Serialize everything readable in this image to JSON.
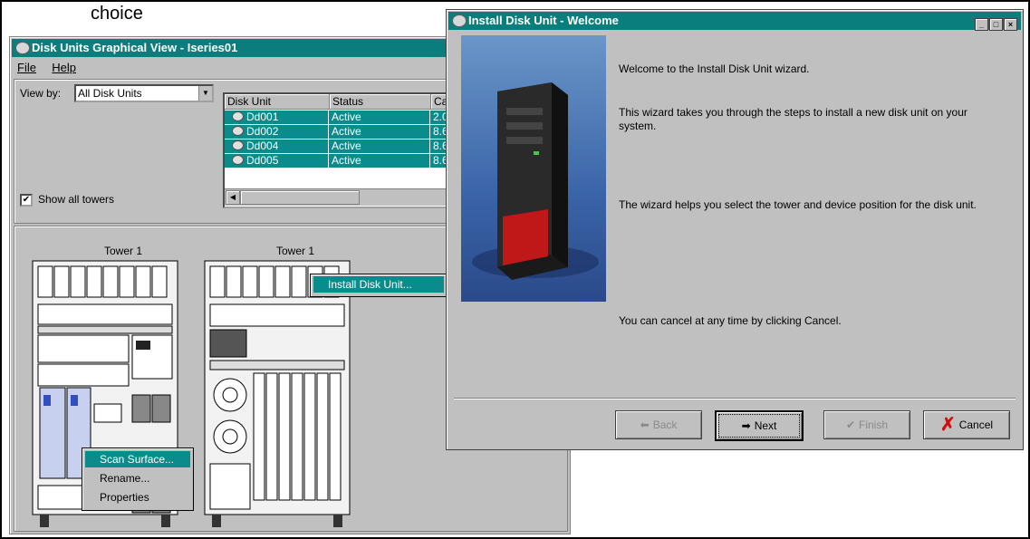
{
  "caption": "choice",
  "left_window": {
    "title": "Disk Units Graphical View - Iseries01",
    "menu": [
      "File",
      "Help"
    ],
    "view_by_label": "View by:",
    "view_by_value": "All Disk Units",
    "show_all_towers_label": "Show all towers",
    "show_all_towers_checked": "✔",
    "table": {
      "columns": [
        "Disk Unit",
        "Status",
        "Ca"
      ],
      "rows": [
        {
          "unit": "Dd001",
          "status": "Active",
          "cap": "2.0"
        },
        {
          "unit": "Dd002",
          "status": "Active",
          "cap": "8.6"
        },
        {
          "unit": "Dd004",
          "status": "Active",
          "cap": "8.6"
        },
        {
          "unit": "Dd005",
          "status": "Active",
          "cap": "8.6"
        }
      ]
    },
    "towers": [
      "Tower 1",
      "Tower 1"
    ],
    "context_menu_tower": [
      "Install Disk Unit..."
    ],
    "context_menu_disk": [
      "Scan Surface...",
      "Rename...",
      "Properties"
    ]
  },
  "right_window": {
    "title": "Install Disk Unit - Welcome",
    "paragraphs": [
      "Welcome to the Install Disk Unit wizard.",
      "This wizard takes you through the steps to install a new disk unit on your system.",
      "The wizard helps you select the tower and device position for the disk unit.",
      "You can cancel at any time by clicking Cancel."
    ],
    "buttons": {
      "back": "Back",
      "next": "Next",
      "finish": "Finish",
      "cancel": "Cancel"
    }
  },
  "colors": {
    "titlebar": "#0a7d7d",
    "selection": "#0a8c8c",
    "window_bg": "#c0c0c0"
  }
}
